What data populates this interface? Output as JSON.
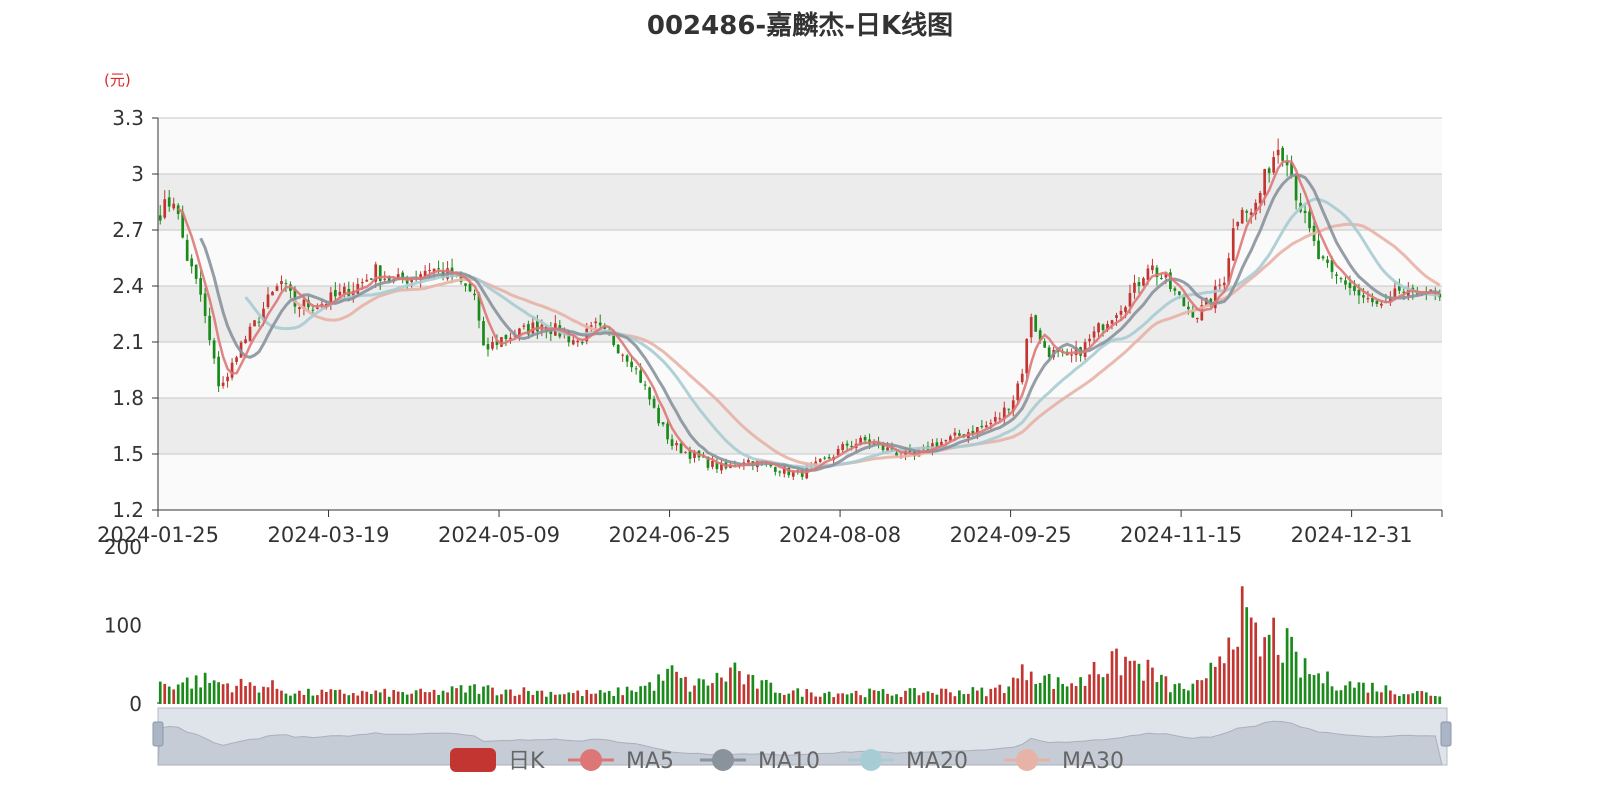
{
  "colors": {
    "up": "#c23531",
    "down": "#1a8a1a",
    "ma5": "#dd7777",
    "ma10": "#8a929c",
    "ma20": "#a8ccd3",
    "ma30": "#e7b3a6",
    "unit": "#d62c2c",
    "slider_fill": "#dfe3ea"
  },
  "chart_data": {
    "type": "candlestick",
    "title": "002486-嘉麟杰-日K线图",
    "price_unit": "(元)",
    "price_axis": {
      "ylim": [
        1.2,
        3.3
      ],
      "ticks": [
        "3.3",
        "3",
        "2.7",
        "2.4",
        "2.1",
        "1.8",
        "1.5",
        "1.2"
      ]
    },
    "volume_axis": {
      "ylim": [
        0,
        200
      ],
      "ticks": [
        "200",
        "100",
        "0"
      ]
    },
    "x_tick_labels": [
      "2024-01-25",
      "2024-03-19",
      "2024-05-09",
      "2024-06-25",
      "2024-08-08",
      "2024-09-25",
      "2024-11-15",
      "2024-12-31"
    ],
    "legend": [
      "日K",
      "MA5",
      "MA10",
      "MA20",
      "MA30"
    ],
    "grid": true,
    "trading_days": 240,
    "close_keypoints": [
      [
        0,
        2.8
      ],
      [
        3,
        2.87
      ],
      [
        6,
        2.55
      ],
      [
        9,
        2.35
      ],
      [
        11,
        2.1
      ],
      [
        13,
        1.88
      ],
      [
        15,
        1.9
      ],
      [
        17,
        2.05
      ],
      [
        20,
        2.15
      ],
      [
        24,
        2.32
      ],
      [
        27,
        2.42
      ],
      [
        30,
        2.3
      ],
      [
        35,
        2.3
      ],
      [
        40,
        2.35
      ],
      [
        45,
        2.42
      ],
      [
        48,
        2.48
      ],
      [
        52,
        2.42
      ],
      [
        56,
        2.45
      ],
      [
        60,
        2.5
      ],
      [
        65,
        2.45
      ],
      [
        70,
        2.35
      ],
      [
        72,
        2.05
      ],
      [
        76,
        2.12
      ],
      [
        80,
        2.15
      ],
      [
        85,
        2.2
      ],
      [
        89,
        2.15
      ],
      [
        93,
        2.1
      ],
      [
        97,
        2.18
      ],
      [
        101,
        2.1
      ],
      [
        105,
        2.0
      ],
      [
        108,
        1.85
      ],
      [
        111,
        1.68
      ],
      [
        114,
        1.55
      ],
      [
        118,
        1.5
      ],
      [
        122,
        1.45
      ],
      [
        126,
        1.42
      ],
      [
        130,
        1.47
      ],
      [
        134,
        1.45
      ],
      [
        138,
        1.42
      ],
      [
        142,
        1.39
      ],
      [
        145,
        1.42
      ],
      [
        149,
        1.48
      ],
      [
        153,
        1.55
      ],
      [
        157,
        1.57
      ],
      [
        161,
        1.53
      ],
      [
        165,
        1.5
      ],
      [
        168,
        1.48
      ],
      [
        172,
        1.55
      ],
      [
        176,
        1.58
      ],
      [
        180,
        1.62
      ],
      [
        184,
        1.65
      ],
      [
        187,
        1.7
      ],
      [
        190,
        1.8
      ],
      [
        192,
        1.95
      ],
      [
        194,
        2.25
      ],
      [
        196,
        2.1
      ],
      [
        198,
        2.05
      ],
      [
        202,
        2.0
      ],
      [
        206,
        2.08
      ],
      [
        210,
        2.2
      ],
      [
        214,
        2.3
      ],
      [
        217,
        2.38
      ],
      [
        220,
        2.52
      ],
      [
        224,
        2.42
      ],
      [
        228,
        2.3
      ],
      [
        231,
        2.25
      ],
      [
        234,
        2.32
      ],
      [
        237,
        2.45
      ],
      [
        239,
        2.7
      ],
      [
        241,
        2.85
      ],
      [
        243,
        2.78
      ],
      [
        245,
        2.9
      ],
      [
        247,
        3.05
      ],
      [
        249,
        3.15
      ],
      [
        251,
        3.1
      ],
      [
        253,
        2.9
      ],
      [
        255,
        2.75
      ],
      [
        258,
        2.55
      ],
      [
        261,
        2.45
      ],
      [
        264,
        2.42
      ],
      [
        267,
        2.35
      ],
      [
        270,
        2.3
      ],
      [
        273,
        2.28
      ],
      [
        276,
        2.38
      ],
      [
        279,
        2.33
      ],
      [
        281,
        2.4
      ],
      [
        283,
        2.35
      ],
      [
        285,
        2.32
      ]
    ],
    "volume_keypoints": [
      [
        0,
        25
      ],
      [
        10,
        30
      ],
      [
        15,
        25
      ],
      [
        25,
        22
      ],
      [
        30,
        14
      ],
      [
        60,
        14
      ],
      [
        70,
        20
      ],
      [
        75,
        18
      ],
      [
        90,
        14
      ],
      [
        100,
        13
      ],
      [
        110,
        25
      ],
      [
        114,
        40
      ],
      [
        118,
        22
      ],
      [
        126,
        35
      ],
      [
        128,
        48
      ],
      [
        130,
        30
      ],
      [
        140,
        15
      ],
      [
        165,
        14
      ],
      [
        175,
        16
      ],
      [
        185,
        16
      ],
      [
        190,
        28
      ],
      [
        194,
        48
      ],
      [
        196,
        35
      ],
      [
        200,
        26
      ],
      [
        206,
        28
      ],
      [
        208,
        58
      ],
      [
        210,
        45
      ],
      [
        215,
        55
      ],
      [
        220,
        42
      ],
      [
        225,
        22
      ],
      [
        229,
        20
      ],
      [
        233,
        25
      ],
      [
        235,
        55
      ],
      [
        237,
        75
      ],
      [
        240,
        120
      ],
      [
        243,
        85
      ],
      [
        245,
        70
      ],
      [
        248,
        88
      ],
      [
        251,
        70
      ],
      [
        254,
        45
      ],
      [
        260,
        30
      ],
      [
        265,
        25
      ],
      [
        270,
        22
      ],
      [
        275,
        17
      ],
      [
        285,
        12
      ]
    ]
  }
}
